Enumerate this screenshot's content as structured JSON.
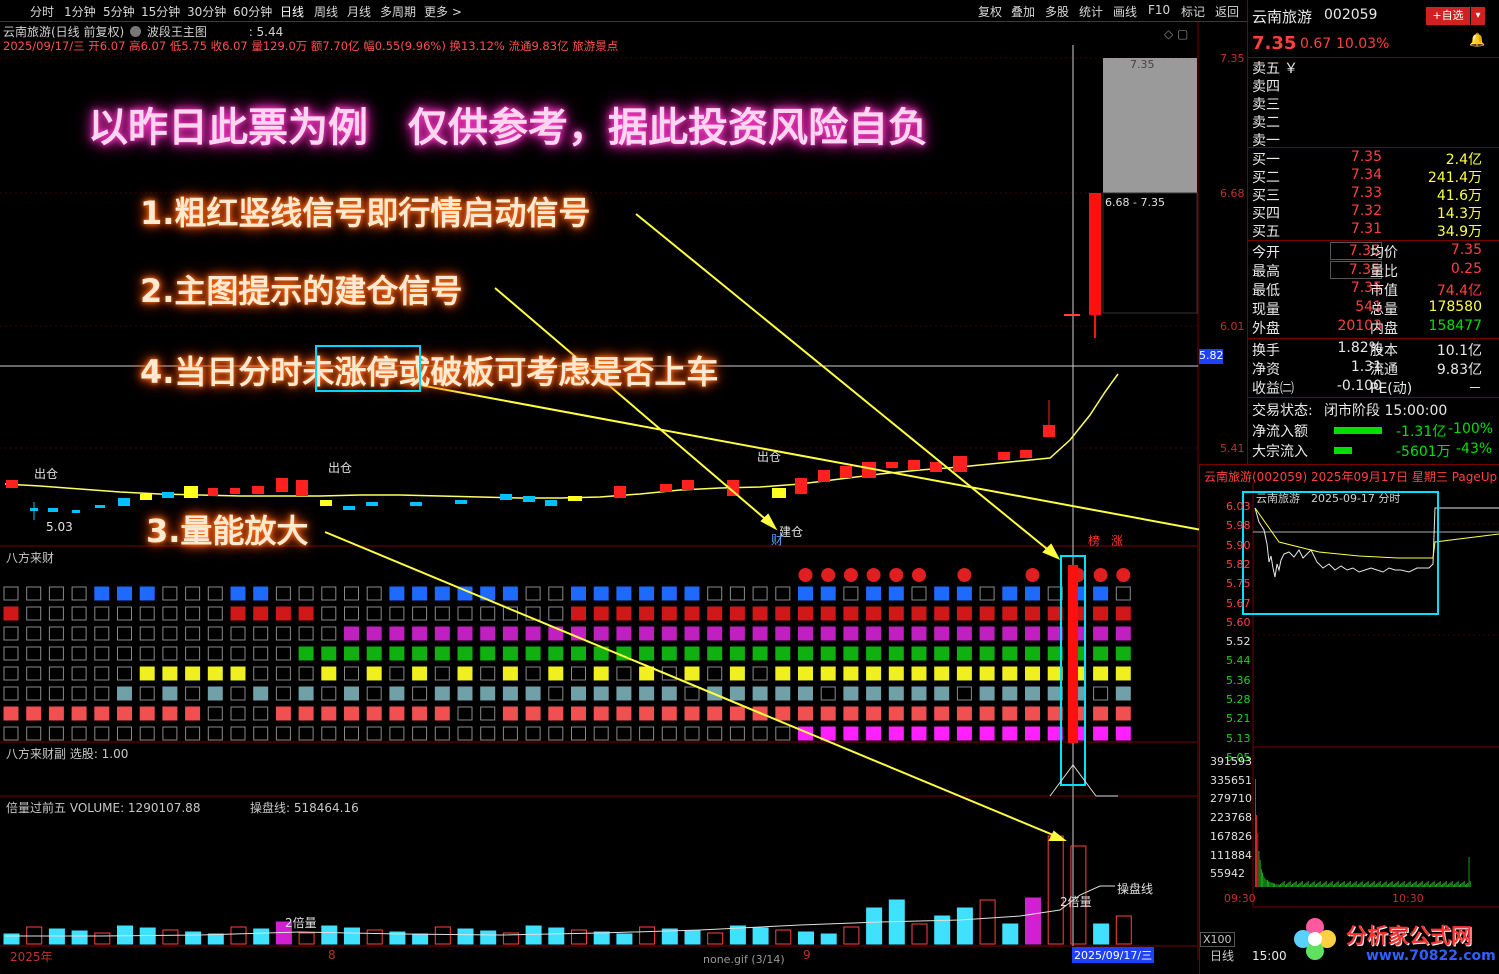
{
  "toolbar": {
    "tabs": [
      "分时",
      "1分钟",
      "5分钟",
      "15分钟",
      "30分钟",
      "60分钟",
      "日线",
      "周线",
      "月线",
      "多周期",
      "更多 >"
    ],
    "right_buttons": [
      "复权",
      "叠加",
      "多股",
      "统计",
      "画线",
      "F10",
      "标记",
      "返回"
    ]
  },
  "chart_header": {
    "line1_name": "云南旅游(日线 前复权)",
    "line1_formula": "波段王主图",
    "line1_value": ": 5.44",
    "line2": "2025/09/17/三 开6.07 高6.07 低5.75 收6.07 量129.0万 额7.70亿 幅0.55(9.96%) 换13.12% 流通9.83亿 旅游景点"
  },
  "price_axis": [
    "7.35",
    "6.68",
    "6.01",
    "5.41"
  ],
  "crosshair_price": "5.82",
  "annotations": {
    "title": "以昨日此票为例　仅供参考，据此投资风险自负",
    "note1": "1.粗红竖线信号即行情启动信号",
    "note2": "2.主图提示的建仓信号",
    "note4": "4.当日分时未涨停或破板可考虑是否上车",
    "note3": "3.量能放大"
  },
  "chart_labels": {
    "chucang1": "出仓",
    "chucang2": "出仓",
    "chucang3": "出仓",
    "jiancang": "建仓",
    "cai": "财",
    "low_price": "5.03",
    "box_range": "6.68 - 7.35",
    "box_top": "7.35",
    "bang": "榜",
    "zhang": "涨"
  },
  "panels": {
    "bafang": "八方来财",
    "bafang_sub": "八方来财副 选股: 1.00",
    "volume": "倍量过前五 VOLUME: 1290107.88",
    "volume_line": "操盘线: 518464.16",
    "double_vol1": "2倍量",
    "double_vol2": "2倍量",
    "caopan": "操盘线"
  },
  "bottom": {
    "year": "2025年",
    "mark8": "8",
    "mark9": "9",
    "date": "2025/09/17/三",
    "status": "none.gif (3/14)"
  },
  "quote": {
    "name": "云南旅游",
    "code": "002059",
    "add_btn": "+自选",
    "price": "7.35",
    "change": "0.67",
    "pct": "10.03%",
    "sells": [
      {
        "label": "卖五",
        "mark": "￥",
        "price": "",
        "vol": ""
      },
      {
        "label": "卖四",
        "mark": "",
        "price": "",
        "vol": ""
      },
      {
        "label": "卖三",
        "mark": "",
        "price": "",
        "vol": ""
      },
      {
        "label": "卖二",
        "mark": "",
        "price": "",
        "vol": ""
      },
      {
        "label": "卖一",
        "mark": "",
        "price": "",
        "vol": ""
      }
    ],
    "buys": [
      {
        "label": "买一",
        "price": "7.35",
        "vol": "2.4亿"
      },
      {
        "label": "买二",
        "price": "7.34",
        "vol": "241.4万"
      },
      {
        "label": "买三",
        "price": "7.33",
        "vol": "41.6万"
      },
      {
        "label": "买四",
        "price": "7.32",
        "vol": "14.3万"
      },
      {
        "label": "买五",
        "price": "7.31",
        "vol": "34.9万"
      }
    ],
    "stats": [
      {
        "l1": "今开",
        "v1": "7.35",
        "l2": "均价",
        "v2": "7.35"
      },
      {
        "l1": "最高",
        "v1": "7.35",
        "l2": "量比",
        "v2": "0.25"
      },
      {
        "l1": "最低",
        "v1": "7.35",
        "l2": "市值",
        "v2": "74.4亿"
      },
      {
        "l1": "现量",
        "v1": "541",
        "l2": "总量",
        "v2": "178580"
      },
      {
        "l1": "外盘",
        "v1": "20103",
        "l2": "内盘",
        "v2": "158477"
      }
    ],
    "stats2": [
      {
        "l1": "换手",
        "v1": "1.82%",
        "l2": "股本",
        "v2": "10.1亿"
      },
      {
        "l1": "净资",
        "v1": "1.31",
        "l2": "流通",
        "v2": "9.83亿"
      },
      {
        "l1": "收益㈡",
        "v1": "-0.100",
        "l2": "PE(动)",
        "v2": "－"
      }
    ],
    "trade_state_label": "交易状态:",
    "trade_state": "闭市阶段 15:00:00",
    "net_inflow_label": "净流入额",
    "net_inflow": "-1.31亿",
    "net_inflow_pct": "-100%",
    "big_inflow_label": "大宗流入",
    "big_inflow": "-5601万",
    "big_inflow_pct": "-43%"
  },
  "intraday": {
    "title": "云南旅游(002059) 2025年09月17日 星期三 PageUp",
    "inset_label": "云南旅游　2025-09-17 分时",
    "prices": [
      "6.03",
      "5.98",
      "5.90",
      "5.82",
      "5.75",
      "5.67",
      "5.60",
      "5.52",
      "5.44",
      "5.36",
      "5.28",
      "5.21",
      "5.13",
      "5.05"
    ],
    "volumes": [
      "391593",
      "335651",
      "279710",
      "223768",
      "167826",
      "111884",
      "55942"
    ],
    "time_start": "09:30",
    "time_end": "10:30",
    "zoom": "X100",
    "period": "日线",
    "close_time": "15:00"
  },
  "watermark": {
    "name": "分析家公式网",
    "url": "www.70822.com"
  }
}
